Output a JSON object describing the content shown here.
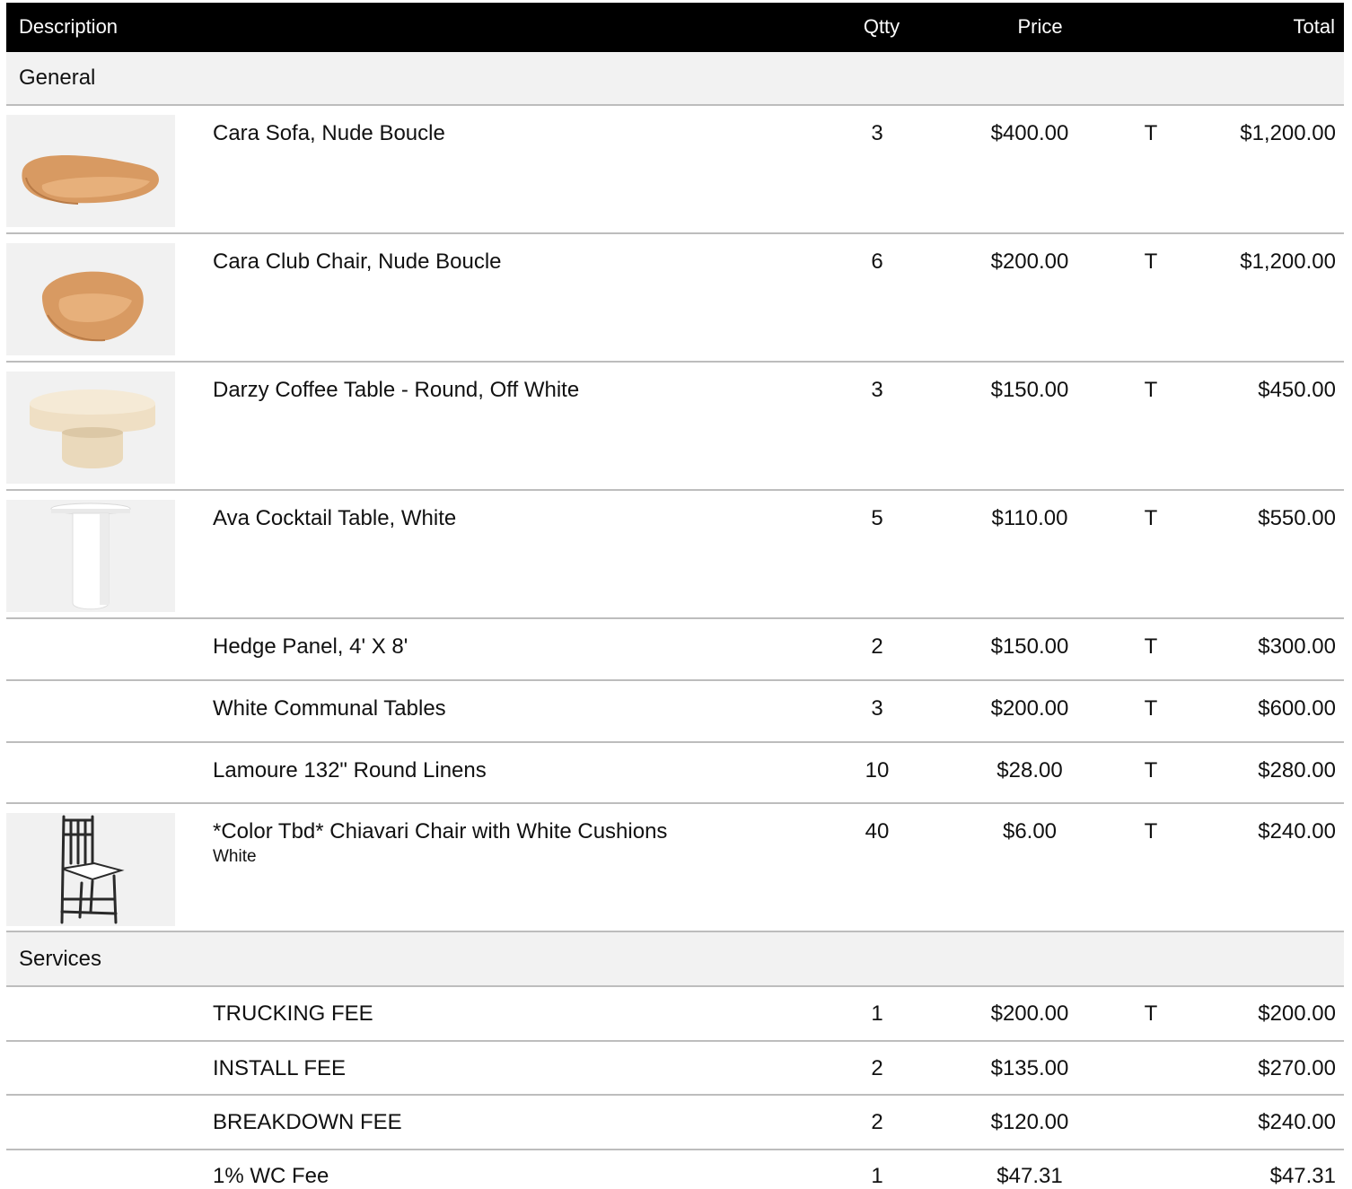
{
  "header": {
    "description": "Description",
    "qtty": "Qtty",
    "price": "Price",
    "total": "Total"
  },
  "sections": {
    "general": "General",
    "services": "Services"
  },
  "general_items": [
    {
      "description": "Cara Sofa, Nude Boucle",
      "qty": "3",
      "price": "$400.00",
      "tax": "T",
      "total": "$1,200.00",
      "image": "sofa-image"
    },
    {
      "description": "Cara Club Chair, Nude Boucle",
      "qty": "6",
      "price": "$200.00",
      "tax": "T",
      "total": "$1,200.00",
      "image": "club-chair-image"
    },
    {
      "description": "Darzy Coffee Table - Round, Off White",
      "qty": "3",
      "price": "$150.00",
      "tax": "T",
      "total": "$450.00",
      "image": "coffee-table-image"
    },
    {
      "description": "Ava Cocktail Table, White",
      "qty": "5",
      "price": "$110.00",
      "tax": "T",
      "total": "$550.00",
      "image": "cocktail-table-image"
    },
    {
      "description": "Hedge Panel, 4' X 8'",
      "qty": "2",
      "price": "$150.00",
      "tax": "T",
      "total": "$300.00"
    },
    {
      "description": "White Communal Tables",
      "qty": "3",
      "price": "$200.00",
      "tax": "T",
      "total": "$600.00"
    },
    {
      "description": "Lamoure 132\" Round Linens",
      "qty": "10",
      "price": "$28.00",
      "tax": "T",
      "total": "$280.00"
    },
    {
      "description": "*Color Tbd* Chiavari Chair with White Cushions",
      "subtext": "White",
      "qty": "40",
      "price": "$6.00",
      "tax": "T",
      "total": "$240.00",
      "image": "chiavari-chair-image"
    }
  ],
  "service_items": [
    {
      "description": "TRUCKING FEE",
      "qty": "1",
      "price": "$200.00",
      "tax": "T",
      "total": "$200.00"
    },
    {
      "description": "INSTALL FEE",
      "qty": "2",
      "price": "$135.00",
      "tax": "",
      "total": "$270.00"
    },
    {
      "description": "BREAKDOWN FEE",
      "qty": "2",
      "price": "$120.00",
      "tax": "",
      "total": "$240.00"
    },
    {
      "description": "1% WC Fee",
      "qty": "1",
      "price": "$47.31",
      "tax": "",
      "total": "$47.31"
    }
  ]
}
